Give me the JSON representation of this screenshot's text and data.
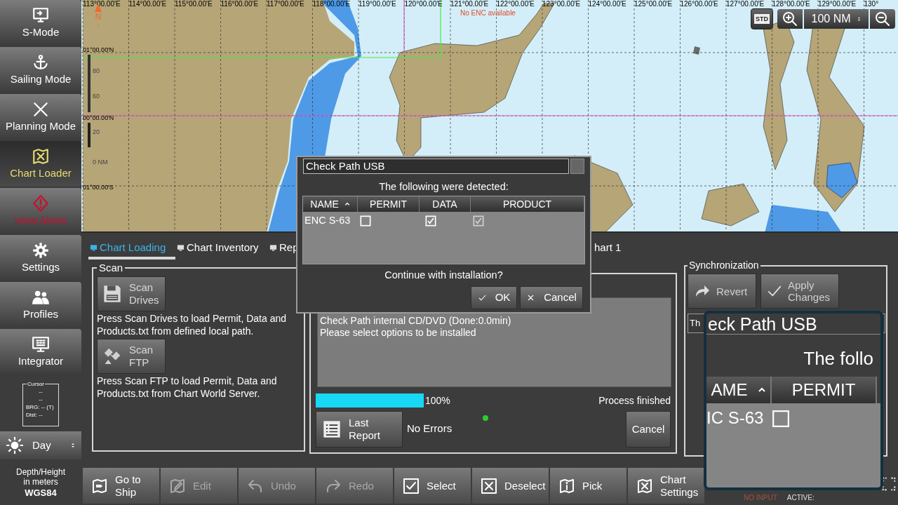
{
  "sidebar": {
    "items": [
      {
        "label": "S-Mode",
        "selected": false,
        "alert": false
      },
      {
        "label": "Sailing Mode",
        "selected": false,
        "alert": false
      },
      {
        "label": "Planning Mode",
        "selected": false,
        "alert": false
      },
      {
        "label": "Chart Loader",
        "selected": true,
        "alert": false
      },
      {
        "label": "View Alerts",
        "selected": false,
        "alert": true
      },
      {
        "label": "Settings",
        "selected": false,
        "alert": false
      },
      {
        "label": "Profiles",
        "selected": false,
        "alert": false
      },
      {
        "label": "Integrator",
        "selected": false,
        "alert": false
      }
    ],
    "cursor_box": {
      "title": "Cursor",
      "lines": [
        "--",
        "--",
        "BRG: -- (T)",
        "Dist: --"
      ]
    },
    "day_select": {
      "value": "Day"
    },
    "datum": {
      "lines": [
        "Depth/Height",
        "in meters"
      ],
      "value": "WGS84"
    }
  },
  "chart": {
    "longitude_labels": [
      "113°00.00'E",
      "114°00.00'E",
      "115°00.00'E",
      "116°00.00'E",
      "117°00.00'E",
      "118°00.00'E",
      "119°00.00'E",
      "120°00.00'E",
      "121°00.00'E",
      "122°00.00'E",
      "123°00.00'E",
      "124°00.00'E",
      "125°00.00'E",
      "126°00.00'E",
      "127°00.00'E",
      "128°00.00'E",
      "129°00.00'E",
      "130°"
    ],
    "latitude_labels": [
      "01°00.00'N",
      "00°00.00'N",
      "01°00.00'S"
    ],
    "north_label": "N",
    "scale_labels": [
      "80",
      "60",
      "20",
      "0 NM"
    ],
    "notice": "No ENC available",
    "std_button": "STD",
    "range_select": {
      "value": "100 NM"
    }
  },
  "tabs": [
    {
      "label": "Chart Loading",
      "selected": true
    },
    {
      "label": "Chart Inventory",
      "selected": false
    },
    {
      "label": "Rep",
      "selected": false
    },
    {
      "label": "hart 1",
      "selected": false
    }
  ],
  "scan": {
    "title": "Scan",
    "buttons": [
      {
        "label": "Scan Drives",
        "description": "Press Scan Drives to load Permit, Data and Products.txt from defined local path."
      },
      {
        "label": "Scan FTP",
        "description": "Press Scan FTP to load Permit, Data and Products.txt from Chart World Server."
      }
    ]
  },
  "progress_panel": {
    "log": [
      "Check Path internal CD/DVD (Done:0.0min)",
      "Please select options to be installed"
    ],
    "level": 1,
    "reading": "100%",
    "status": "Process finished",
    "last_report_button": "Last Report",
    "errors": "No Errors",
    "cancel_button": "Cancel"
  },
  "sync": {
    "title": "Synchronization",
    "buttons": [
      "Revert",
      "Apply Changes"
    ],
    "field_value": "Th"
  },
  "dialog": {
    "title": "Check Path USB",
    "message": "The following were detected:",
    "columns": [
      {
        "label": "NAME",
        "sorted": true
      },
      {
        "label": "PERMIT",
        "sorted": false
      },
      {
        "label": "DATA",
        "sorted": false
      },
      {
        "label": "PRODUCT",
        "sorted": false
      }
    ],
    "rows": [
      {
        "name": "ENC S-63",
        "cells": [
          {
            "checked": false,
            "disabled": false
          },
          {
            "checked": true,
            "disabled": false
          },
          {
            "checked": true,
            "disabled": true
          }
        ]
      }
    ],
    "question": "Continue with installation?",
    "buttons": [
      {
        "kind": "ok",
        "label": "OK"
      },
      {
        "kind": "cancel",
        "label": "Cancel"
      }
    ]
  },
  "magnifier": {
    "title": "eck Path USB",
    "message": "The follo",
    "columns": [
      {
        "label": "AME",
        "sorted": true
      },
      {
        "label": "PERMIT",
        "sorted": false
      }
    ],
    "row": {
      "name": "IC S-63",
      "checked": false
    }
  },
  "toolbar": [
    {
      "label": "Go to Ship",
      "disabled": false
    },
    {
      "label": "Edit",
      "disabled": true
    },
    {
      "label": "Undo",
      "disabled": true
    },
    {
      "label": "Redo",
      "disabled": true
    },
    {
      "label": "Select",
      "disabled": false
    },
    {
      "label": "Deselect",
      "disabled": false
    },
    {
      "label": "Pick",
      "disabled": false
    },
    {
      "label": "Chart Settings",
      "disabled": false
    }
  ],
  "status_bar": {
    "input": "NO INPUT",
    "active": "ACTIVE:"
  }
}
